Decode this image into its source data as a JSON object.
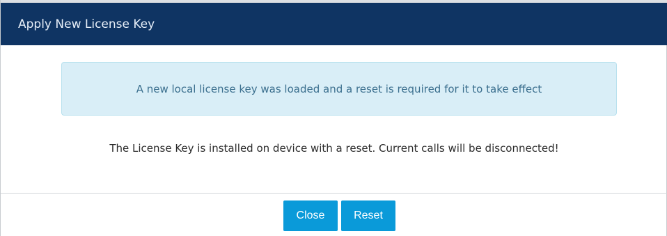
{
  "dialog": {
    "title": "Apply New License Key",
    "alert_message": "A new local license key was loaded and a reset is required for it to take effect",
    "warning_message": "The License Key is installed on device with a reset. Current calls will be disconnected!",
    "buttons": {
      "close_label": "Close",
      "reset_label": "Reset"
    }
  },
  "colors": {
    "titlebar": "#0f3463",
    "alert_background": "#d9eef7",
    "alert_text": "#3b6f8e",
    "button_primary": "#0a9ad9"
  }
}
